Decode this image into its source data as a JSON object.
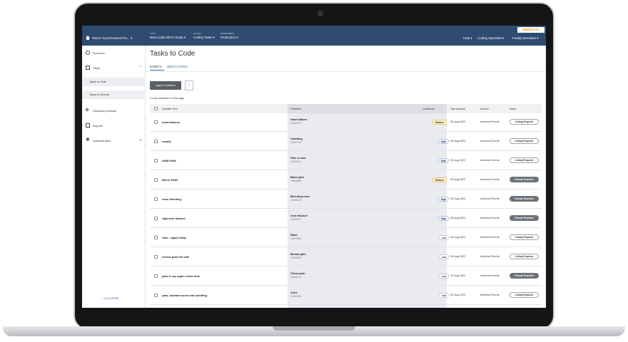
{
  "topbar": {
    "app_name": "RaveX Synchronized Pre...",
    "study": {
      "label": "STUDY",
      "value": "New Coder BETA Study"
    },
    "actions": {
      "label": "ACTIONS",
      "value": "Coding Tasks"
    },
    "environments": {
      "label": "ENVIRONMENTS",
      "value": "Production"
    },
    "logo": "MEDIDATA",
    "help": "Help",
    "role": "Coding Specialist",
    "user": "Freddy Mendieta"
  },
  "sidebar": {
    "overview": "Overview",
    "tasks": "Tasks",
    "tasks_to_code": "Tasks to Code",
    "tasks_to_recode": "Tasks to Recode",
    "dictionary_browser": "Dictionary Browser",
    "reports": "Reports",
    "administration": "Administration",
    "collapse": "COLLAPSE"
  },
  "main": {
    "title": "Tasks to Code",
    "tabs": [
      "EVENTS",
      "MEDICATIONS"
    ],
    "apply_prediction": "Apply Prediction",
    "selected_text": "0 rows selected on this page"
  },
  "table": {
    "headers": {
      "verbatim": "Verbatim Term",
      "prediction": "Prediction",
      "confidence": "Confidence",
      "task_updated": "Task Updated",
      "domain": "Domain",
      "status": "Status"
    },
    "rows": [
      {
        "term": "heart failures",
        "prediction": "Heart failure",
        "code": "10019279",
        "confidence": "Medium",
        "date": "05 Aug 2022",
        "domain": "Adverse Events",
        "status": "Coding Required"
      },
      {
        "term": "vomits",
        "prediction": "Vomiting",
        "code": "10047700",
        "confidence": "High",
        "date": "05 Aug 2022",
        "domain": "Adverse Events",
        "status": "Coding Required"
      },
      {
        "term": "ARM PAIN",
        "prediction": "Pain in arm",
        "code": "10033421",
        "confidence": "High",
        "date": "05 Aug 2022",
        "domain": "Adverse Events",
        "status": "Coding Required"
      },
      {
        "term": "BACK PAIN",
        "prediction": "Back pain",
        "code": "10003988",
        "confidence": "Medium",
        "date": "05 Aug 2022",
        "domain": "Adverse Events",
        "status": "Recode Required"
      },
      {
        "term": "nose bleeding",
        "prediction": "Bleeding nose",
        "code": "10005124",
        "confidence": "High",
        "date": "05 Aug 2022",
        "domain": "Adverse Events",
        "status": "Recode Required"
      },
      {
        "term": "right arm fracture",
        "prediction": "Arm fracture",
        "code": "10049127",
        "confidence": "High",
        "date": "05 Aug 2022",
        "domain": "Adverse Events",
        "status": "Recode Required"
      },
      {
        "term": "rash - upper body",
        "prediction": "Rash",
        "code": "10037844",
        "confidence": "Low",
        "date": "05 Aug 2022",
        "domain": "Adverse Events",
        "status": "Coding Required"
      },
      {
        "term": "chesst pain left side",
        "prediction": "Breast pain",
        "code": "10006298",
        "confidence": "Low",
        "date": "05 Aug 2022",
        "domain": "Adverse Events",
        "status": "Coding Required"
      },
      {
        "term": "pain in my upper chest area",
        "prediction": "Chest pain",
        "code": "10008479",
        "confidence": "Low",
        "date": "02 Aug 2022",
        "domain": "Adverse Events",
        "status": "Recode Required"
      },
      {
        "term": "pain, stomach ache and vomiting",
        "prediction": "Ache",
        "code": "10000424",
        "confidence": "Low",
        "date": "02 Aug 2022",
        "domain": "Adverse Events",
        "status": "Coding Required"
      }
    ]
  }
}
